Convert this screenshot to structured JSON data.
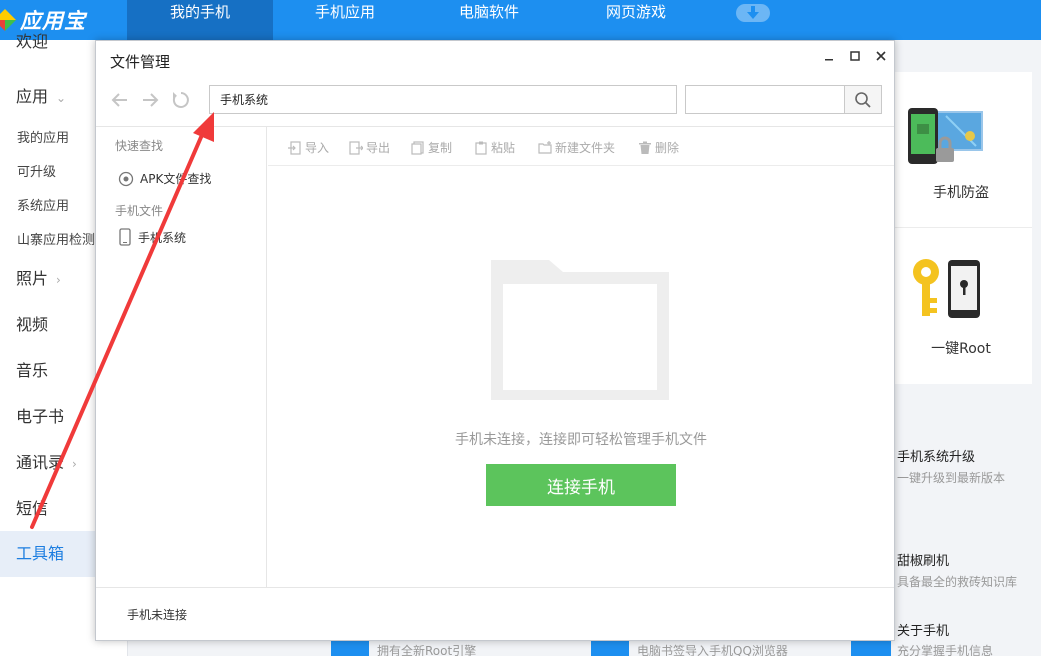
{
  "app": {
    "name": "应用宝",
    "nav_tabs": [
      {
        "label": "我的手机",
        "active": true
      },
      {
        "label": "手机应用",
        "active": false
      },
      {
        "label": "电脑软件",
        "active": false
      },
      {
        "label": "网页游戏",
        "active": false
      }
    ]
  },
  "sidebar": {
    "items": [
      {
        "label": "欢迎"
      },
      {
        "label": "应用",
        "chevron": "⌄"
      },
      {
        "label": "我的应用"
      },
      {
        "label": "可升级"
      },
      {
        "label": "系统应用"
      },
      {
        "label": "山寨应用检测"
      },
      {
        "label": "照片",
        "chevron": "›"
      },
      {
        "label": "视频"
      },
      {
        "label": "音乐"
      },
      {
        "label": "电子书"
      },
      {
        "label": "通讯录",
        "chevron": "›"
      },
      {
        "label": "短信"
      },
      {
        "label": "工具箱"
      }
    ]
  },
  "right_panel": {
    "card_anti_theft": "手机防盗",
    "card_root": "一键Root",
    "tools": [
      {
        "title": "手机系统升级",
        "desc": "一键升级到最新版本"
      },
      {
        "title": "甜椒刷机",
        "desc": "具备最全的救砖知识库"
      },
      {
        "title": "关于手机",
        "desc": "充分掌握手机信息"
      }
    ],
    "bottom_items": [
      "拥有全新Root引擎",
      "电脑书签导入手机QQ浏览器"
    ]
  },
  "dialog": {
    "title": "文件管理",
    "path_value": "手机系统",
    "search_value": "",
    "sidebar": {
      "quick_search": "快速查找",
      "apk_search": "APK文件查找",
      "phone_files": "手机文件",
      "phone_system": "手机系统"
    },
    "toolbar": {
      "import": "导入",
      "export": "导出",
      "copy": "复制",
      "paste": "粘贴",
      "new_folder": "新建文件夹",
      "delete": "删除"
    },
    "empty_message": "手机未连接，连接即可轻松管理手机文件",
    "connect_button": "连接手机",
    "status": "手机未连接"
  },
  "colors": {
    "brand_blue": "#1d8ff0",
    "connect_green": "#5cc45c",
    "annotation_red": "#f03a3a"
  }
}
